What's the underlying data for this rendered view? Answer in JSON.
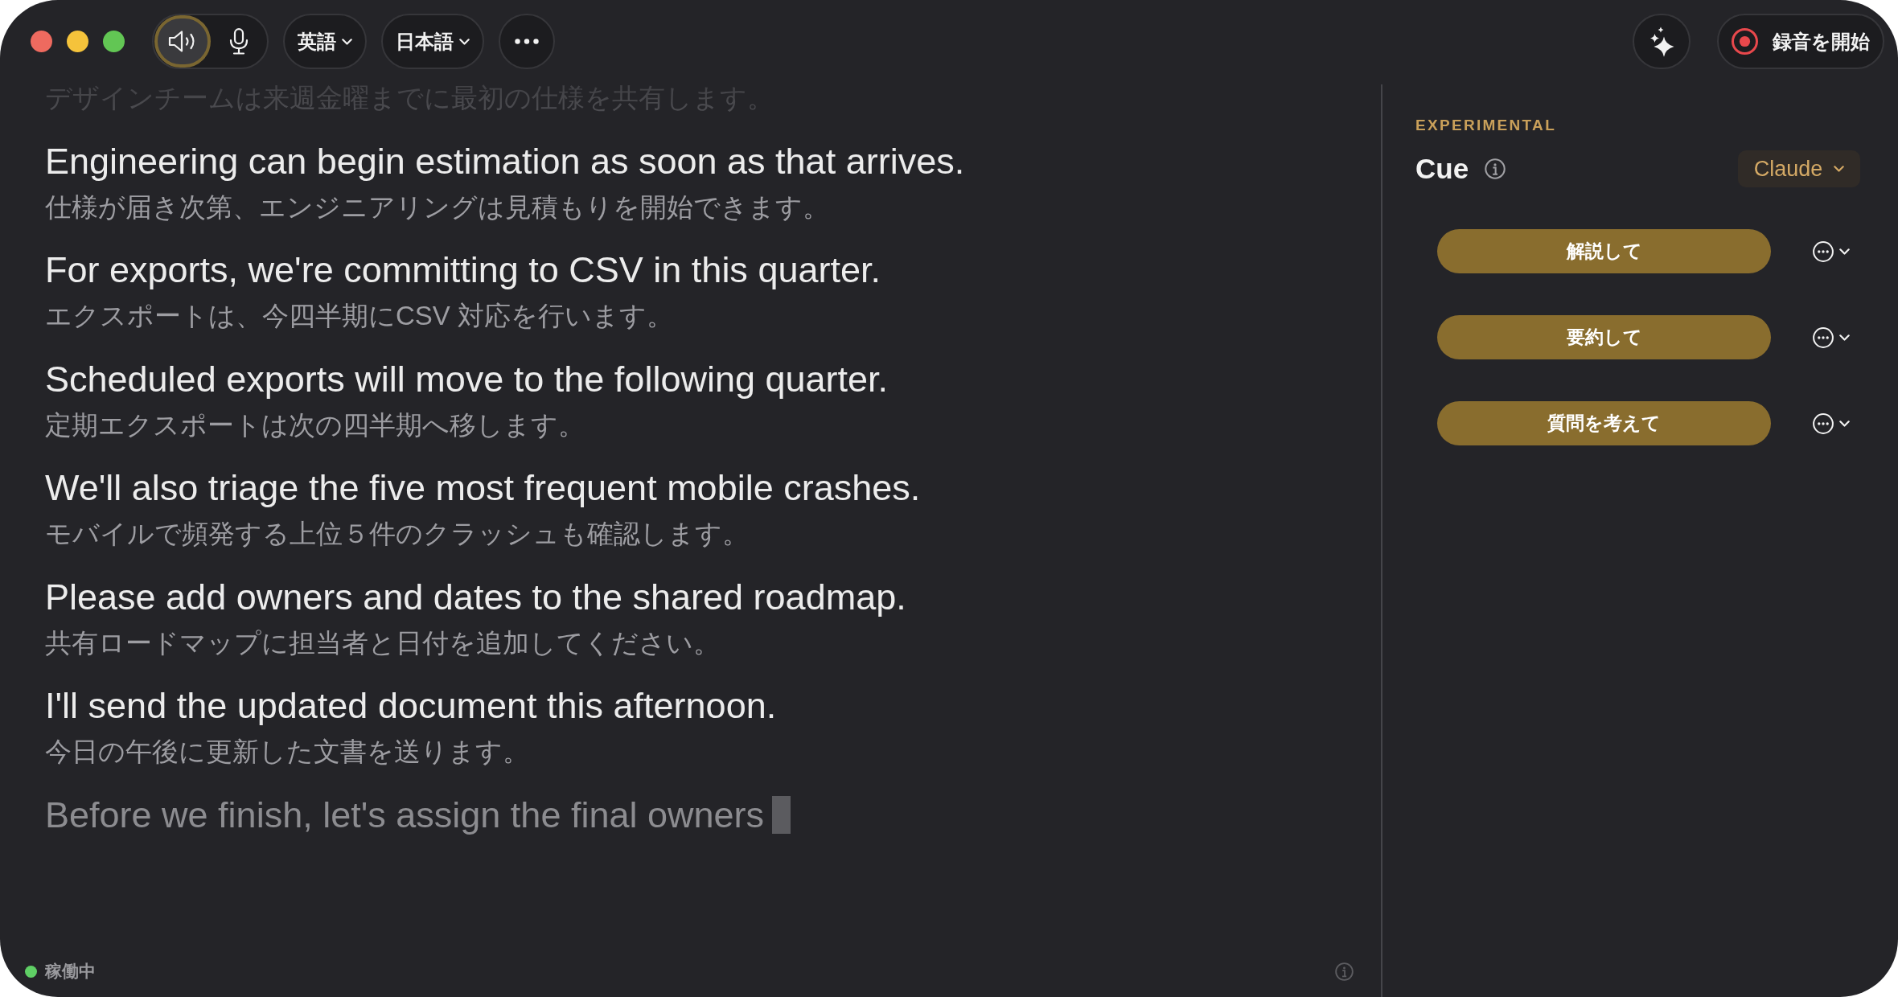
{
  "toolbar": {
    "audio_sources": [
      {
        "kind": "speaker",
        "selected": true
      },
      {
        "kind": "microphone",
        "selected": false
      }
    ],
    "source_language": "英語",
    "target_language": "日本語",
    "record_button": "録音を開始"
  },
  "transcript": [
    {
      "translation": "デザインチームは来週金曜までに最初の仕様を共有します。",
      "interim": false
    },
    {
      "source": "Engineering can begin estimation as soon as that arrives.",
      "translation": "仕様が届き次第、エンジニアリングは見積もりを開始できます。",
      "interim": false
    },
    {
      "source": "For exports, we're committing to CSV in this quarter.",
      "translation": "エクスポートは、今四半期にCSV 対応を行います。",
      "interim": false
    },
    {
      "source": "Scheduled exports will move to the following quarter.",
      "translation": "定期エクスポートは次の四半期へ移します。",
      "interim": false
    },
    {
      "source": "We'll also triage the five most frequent mobile crashes.",
      "translation": "モバイルで頻発する上位５件のクラッシュも確認します。",
      "interim": false
    },
    {
      "source": "Please add owners and dates to the shared roadmap.",
      "translation": "共有ロードマップに担当者と日付を追加してください。",
      "interim": false
    },
    {
      "source": "I'll send the updated document this afternoon.",
      "translation": "今日の午後に更新した文書を送ります。",
      "interim": false
    },
    {
      "source": "Before we finish, let's assign the final owners",
      "interim": true
    }
  ],
  "status_bar": {
    "label": "稼働中",
    "active": true
  },
  "cue_panel": {
    "tag": "EXPERIMENTAL",
    "title": "Cue",
    "model": "Claude",
    "actions": [
      {
        "label": "解説して"
      },
      {
        "label": "要約して"
      },
      {
        "label": "質問を考えて"
      }
    ]
  }
}
